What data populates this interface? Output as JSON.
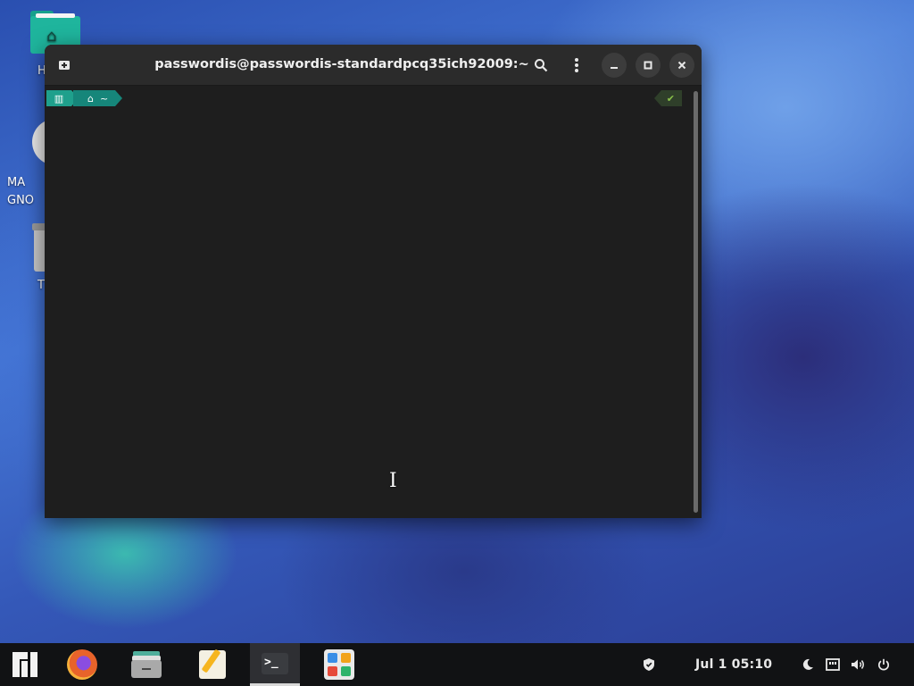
{
  "desktop": {
    "icons": [
      {
        "label": "H"
      },
      {
        "label": "MA\nGNO"
      },
      {
        "label": "T"
      }
    ]
  },
  "terminal": {
    "title": "passwordis@passwordis-standardpcq35ich92009:~",
    "prompt": {
      "dir_glyph": "~",
      "status_glyph": "✔"
    }
  },
  "taskbar": {
    "apps": [
      "manjaro-menu",
      "firefox",
      "files",
      "text-editor",
      "terminal",
      "software-store"
    ],
    "clock": "Jul 1  05:10"
  },
  "colors": {
    "accent": "#1fa08c",
    "taskbar_bg": "#111214",
    "terminal_bg": "#1e1e1e"
  }
}
